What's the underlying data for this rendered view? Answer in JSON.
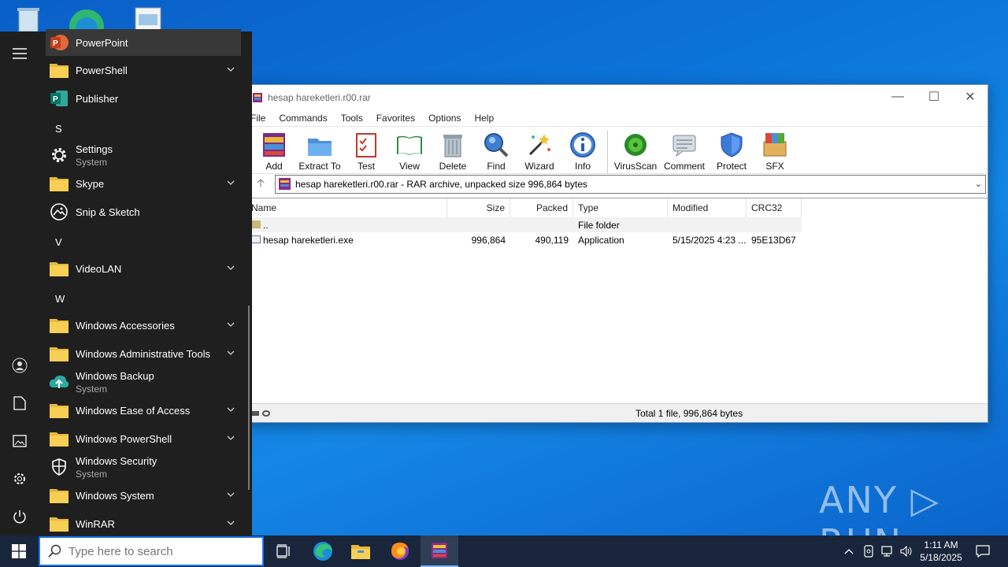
{
  "desktop": {
    "watermark": "ANY ▷ RUN"
  },
  "winrar": {
    "title": "hesap hareketleri.r00.rar",
    "menu": [
      "File",
      "Commands",
      "Tools",
      "Favorites",
      "Options",
      "Help"
    ],
    "toolbar": [
      {
        "label": "Add",
        "icon": "add-icon"
      },
      {
        "label": "Extract To",
        "icon": "extract-icon"
      },
      {
        "label": "Test",
        "icon": "test-icon"
      },
      {
        "label": "View",
        "icon": "view-icon"
      },
      {
        "label": "Delete",
        "icon": "delete-icon"
      },
      {
        "label": "Find",
        "icon": "find-icon"
      },
      {
        "label": "Wizard",
        "icon": "wizard-icon"
      },
      {
        "label": "Info",
        "icon": "info-icon"
      },
      {
        "label": "VirusScan",
        "icon": "virusscan-icon"
      },
      {
        "label": "Comment",
        "icon": "comment-icon"
      },
      {
        "label": "Protect",
        "icon": "protect-icon"
      },
      {
        "label": "SFX",
        "icon": "sfx-icon"
      }
    ],
    "address": "hesap hareketleri.r00.rar - RAR archive, unpacked size 996,864 bytes",
    "columns": {
      "name": "Name",
      "size": "Size",
      "packed": "Packed",
      "type": "Type",
      "modified": "Modified",
      "crc": "CRC32"
    },
    "rows": [
      {
        "name": "..",
        "size": "",
        "packed": "",
        "type": "File folder",
        "modified": "",
        "crc": ""
      },
      {
        "name": "hesap hareketleri.exe",
        "size": "996,864",
        "packed": "490,119",
        "type": "Application",
        "modified": "5/15/2025 4:23 ...",
        "crc": "95E13D67"
      }
    ],
    "status": "Total 1 file, 996,864 bytes"
  },
  "start_menu": {
    "items": [
      {
        "label": "PowerPoint",
        "icon": "powerpoint-icon"
      },
      {
        "label": "PowerShell",
        "icon": "folder-icon",
        "expand": true
      },
      {
        "label": "Publisher",
        "icon": "publisher-icon"
      },
      {
        "letter": "S"
      },
      {
        "label": "Settings",
        "sub": "System",
        "icon": "gear-icon"
      },
      {
        "label": "Skype",
        "icon": "folder-icon",
        "expand": true
      },
      {
        "label": "Snip & Sketch",
        "icon": "snip-sketch-icon"
      },
      {
        "letter": "V"
      },
      {
        "label": "VideoLAN",
        "icon": "folder-icon",
        "expand": true
      },
      {
        "letter": "W"
      },
      {
        "label": "Windows Accessories",
        "icon": "folder-icon",
        "expand": true
      },
      {
        "label": "Windows Administrative Tools",
        "icon": "folder-icon",
        "expand": true
      },
      {
        "label": "Windows Backup",
        "sub": "System",
        "icon": "backup-icon"
      },
      {
        "label": "Windows Ease of Access",
        "icon": "folder-icon",
        "expand": true
      },
      {
        "label": "Windows PowerShell",
        "icon": "folder-icon",
        "expand": true
      },
      {
        "label": "Windows Security",
        "sub": "System",
        "icon": "shield-icon"
      },
      {
        "label": "Windows System",
        "icon": "folder-icon",
        "expand": true
      },
      {
        "label": "WinRAR",
        "icon": "folder-icon",
        "expand": true
      }
    ]
  },
  "taskbar": {
    "search_placeholder": "Type here to search",
    "time": "1:11 AM",
    "date": "5/18/2025"
  }
}
